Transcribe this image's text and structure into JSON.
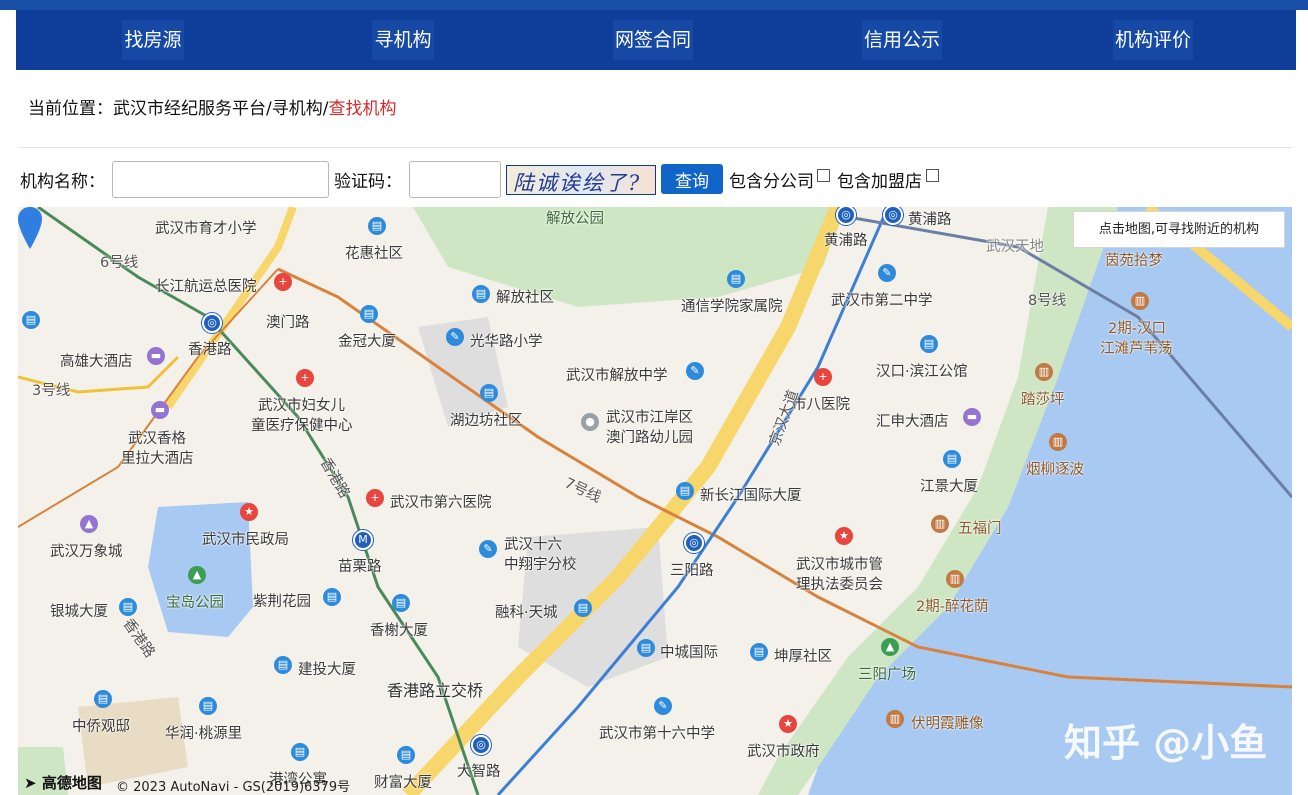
{
  "nav": {
    "items": [
      "找房源",
      "寻机构",
      "网签合同",
      "信用公示",
      "机构评价"
    ]
  },
  "breadcrumb": {
    "prefix": "当前位置：",
    "path": "武汉市经纪服务平台/寻机构/",
    "current": "查找机构"
  },
  "search": {
    "name_label": "机构名称：",
    "name_value": "",
    "captcha_label": "验证码：",
    "captcha_value": "",
    "captcha_text": "陆诚诶绘了?",
    "query_label": "查询",
    "include_branch_label": "包含分公司",
    "include_franchise_label": "包含加盟店"
  },
  "map": {
    "tip": "点击地图,可寻找附近的机构",
    "logo": "高德地图",
    "copyright": "© 2023 AutoNavi - GS(2019)6379号",
    "watermark": "知乎 @小鱼",
    "labels": {
      "jiefang_park": "解放公园",
      "yucai": "武汉市育才小学",
      "huahui": "花惠社区",
      "huangpu_rd": "黄浦路",
      "huangpu_metro": "黄浦路",
      "wuhan_tiandi": "武汉天地",
      "yinyuan": "茵苑拾梦",
      "line6": "6号线",
      "changjiang_hosp": "长江航运总医院",
      "jiefang_sq": "解放社区",
      "tongxin": "通信学院家属院",
      "no2_middle": "武汉市第二中学",
      "phase2_hankou": "2期-汉口",
      "jiangtan": "江滩芦苇荡",
      "line8": "8号线",
      "aomen_rd": "澳门路",
      "jinguan": "金冠大厦",
      "guanghua": "光华路小学",
      "xianggang_rd": "香港路",
      "gaoxiong": "高雄大酒店",
      "jiefang_middle": "武汉市解放中学",
      "binjiang": "汉口·滨江公馆",
      "line3": "3号线",
      "no8_hosp": "市八医院",
      "lushaping": "踏莎坪",
      "fuyou": "武汉市妇女儿",
      "fuyou2": "童医疗保健中心",
      "hubianfang": "湖边坊社区",
      "jiangan_kinder": "武汉市江岸区",
      "jiangan_kinder2": "澳门路幼儿园",
      "jingshen": "汇申大酒店",
      "xiangge": "武汉香格",
      "xiangge2": "里拉大酒店",
      "yanliu": "烟柳逐波",
      "xianggang_rd2": "香港路",
      "jinghan": "京汉大道",
      "xinchangjiang": "新长江国际大厦",
      "jiangjing": "江景大厦",
      "line7": "7号线",
      "no6_hosp": "武汉市第六医院",
      "wanxiang": "武汉万象城",
      "minzheng": "武汉市民政局",
      "miaoli": "苗栗路",
      "no16_a": "武汉十六",
      "no16_b": "中翔宇分校",
      "wufumen": "五福门",
      "sanyang": "三阳路",
      "chengguan": "武汉市城市管",
      "chengguan2": "理执法委员会",
      "yincheng": "银城大厦",
      "baodao": "宝岛公园",
      "zijing": "紫荆花园",
      "xiangshu": "香榭大厦",
      "rongke": "融科·天城",
      "zuihuayin": "2期-醉花荫",
      "zhongcheng": "中城国际",
      "kunhou": "坤厚社区",
      "sanyang_sq": "三阳广场",
      "jiantou": "建投大厦",
      "xianggang_bridge": "香港路立交桥",
      "zhongqiao": "中侨观邸",
      "huarun": "华润·桃源里",
      "jiangshan": "港湾公寓",
      "caifu": "财富大厦",
      "dazhi": "大智路",
      "no16_middle": "武汉市第十六中学",
      "shizhengfu": "武汉市政府",
      "fuming": "伏明霞雕像"
    }
  }
}
